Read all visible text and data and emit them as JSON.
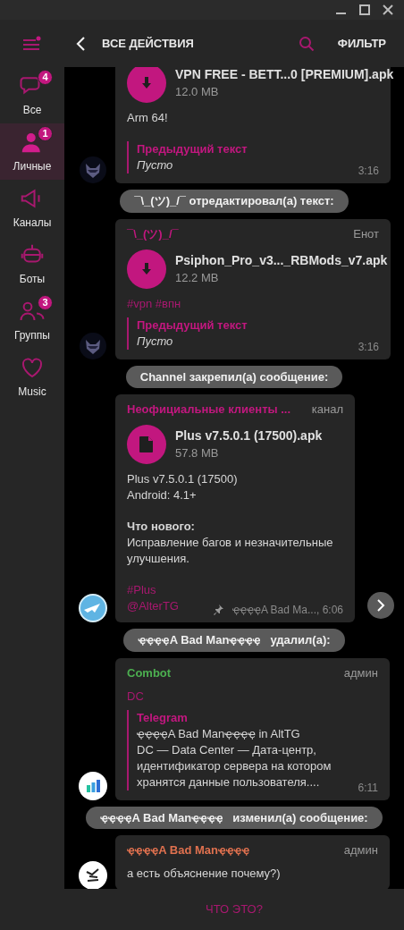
{
  "header": {
    "title": "ВСЕ ДЕЙСТВИЯ",
    "filter": "ФИЛЬТР"
  },
  "sidebar": {
    "items": [
      {
        "label": "Все",
        "badge": "4",
        "selected": false
      },
      {
        "label": "Личные",
        "badge": "1",
        "selected": true
      },
      {
        "label": "Каналы",
        "selected": false
      },
      {
        "label": "Боты",
        "selected": false
      },
      {
        "label": "Группы",
        "badge": "3",
        "selected": false
      },
      {
        "label": "Music",
        "selected": false
      }
    ]
  },
  "messages": [
    {
      "kind": "message",
      "file": {
        "kind": "download",
        "name": "VPN FREE - BETT...0 [PREMIUM].apk",
        "size": "12.0 MB"
      },
      "text": [
        "Arm 64!"
      ],
      "quote": {
        "title": "Предыдущий текст",
        "lines": [
          "Пусто"
        ],
        "italic": true
      },
      "time": "3:16"
    },
    {
      "kind": "service",
      "text": "¯\\_(ツ)_/¯ отредактировал(а) текст:"
    },
    {
      "kind": "message",
      "author": "¯\\_(ツ)_/¯",
      "color": "#c2177f",
      "tag": "Енот",
      "file": {
        "kind": "download",
        "name": "Psiphon_Pro_v3..._RBMods_v7.apk",
        "size": "12.2 MB"
      },
      "hashtags": [
        "#vpn #впн"
      ],
      "quote": {
        "title": "Предыдущий текст",
        "lines": [
          "Пусто"
        ],
        "italic": true
      },
      "time": "3:16"
    },
    {
      "kind": "service",
      "text": "Channel закрепил(а) сообщение:"
    },
    {
      "kind": "message",
      "author": "Неофициальные клиенты ...",
      "color": "#c2177f",
      "tag": "канал",
      "file": {
        "kind": "document",
        "name": "Plus v7.5.0.1 (17500).apk",
        "size": "57.8 MB"
      },
      "text": [
        "Plus v7.5.0.1 (17500)\nAndroid: 4.1+",
        "**Что нового:**\nИсправление багов и незначительные улучшения."
      ],
      "hashtags": [
        "#Plus",
        "@AlterTG"
      ],
      "pinned": true,
      "signature": "ҿҿҿҿA Bad Ma..., 6:06",
      "forward": true
    },
    {
      "kind": "service",
      "text": "ҿҿҿҿA Bad Manҿҿҿҿ   удалил(а):"
    },
    {
      "kind": "message",
      "author": "Combot",
      "color": "#4caf50",
      "tag": "админ",
      "hashtags": [
        "DC"
      ],
      "quote": {
        "title": "Telegram",
        "lines": [
          "ҿҿҿҿA Bad Manҿҿҿҿ   in AltTG",
          "DC — Data Center — Дата-центр, идентификатор сервера на котором хранятся данные пользователя...."
        ],
        "italic": false
      },
      "time": "6:11"
    },
    {
      "kind": "service",
      "text": "ҿҿҿҿA Bad Manҿҿҿҿ   изменил(а) сообщение:"
    },
    {
      "kind": "message",
      "author": "ҿҿҿҿA Bad Manҿҿҿҿ",
      "color": "#e0714f",
      "tag": "админ",
      "text": [
        "а есть объяснение почему?)"
      ]
    }
  ],
  "bottom_button": "ЧТО ЭТО?"
}
